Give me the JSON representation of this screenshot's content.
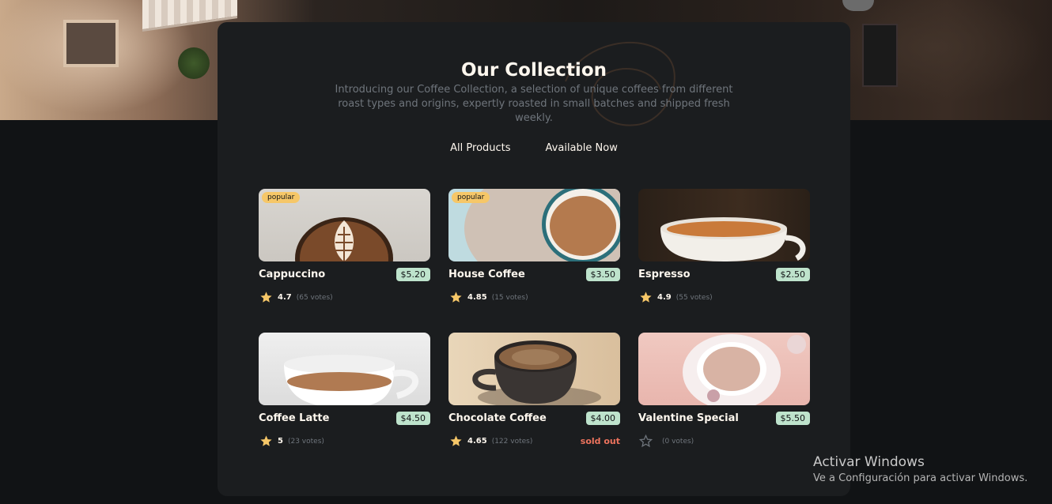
{
  "colors": {
    "page_bg": "#111315",
    "panel_bg": "#1B1D1F",
    "text_primary": "#FEF7EE",
    "text_muted": "#6F757C",
    "badge_bg": "#F6C768",
    "price_bg": "#BEE3CC",
    "star": "#F6C768",
    "sold_out": "#ED735D"
  },
  "header": {
    "title": "Our Collection",
    "subtitle": "Introducing our Coffee Collection, a selection of unique coffees from different roast types and origins, expertly roasted in small batches and shipped fresh weekly."
  },
  "filters": [
    {
      "label": "All Products",
      "active": true
    },
    {
      "label": "Available Now",
      "active": false
    }
  ],
  "products": [
    {
      "name": "Cappuccino",
      "price": "$5.20",
      "badge": "popular",
      "rating": "4.7",
      "votes": "(65 votes)",
      "sold_out": "",
      "image_icon": "cappuccino-photo"
    },
    {
      "name": "House Coffee",
      "price": "$3.50",
      "badge": "popular",
      "rating": "4.85",
      "votes": "(15 votes)",
      "sold_out": "",
      "image_icon": "house-coffee-photo"
    },
    {
      "name": "Espresso",
      "price": "$2.50",
      "badge": "",
      "rating": "4.9",
      "votes": "(55 votes)",
      "sold_out": "",
      "image_icon": "espresso-photo"
    },
    {
      "name": "Coffee Latte",
      "price": "$4.50",
      "badge": "",
      "rating": "5",
      "votes": "(23 votes)",
      "sold_out": "",
      "image_icon": "coffee-latte-photo"
    },
    {
      "name": "Chocolate Coffee",
      "price": "$4.00",
      "badge": "",
      "rating": "4.65",
      "votes": "(122 votes)",
      "sold_out": "sold out",
      "image_icon": "chocolate-coffee-photo"
    },
    {
      "name": "Valentine Special",
      "price": "$5.50",
      "badge": "",
      "rating": "",
      "votes": "(0 votes)",
      "sold_out": "",
      "image_icon": "valentine-special-photo"
    }
  ],
  "watermark": {
    "title": "Activar Windows",
    "subtitle": "Ve a Configuración para activar Windows."
  }
}
